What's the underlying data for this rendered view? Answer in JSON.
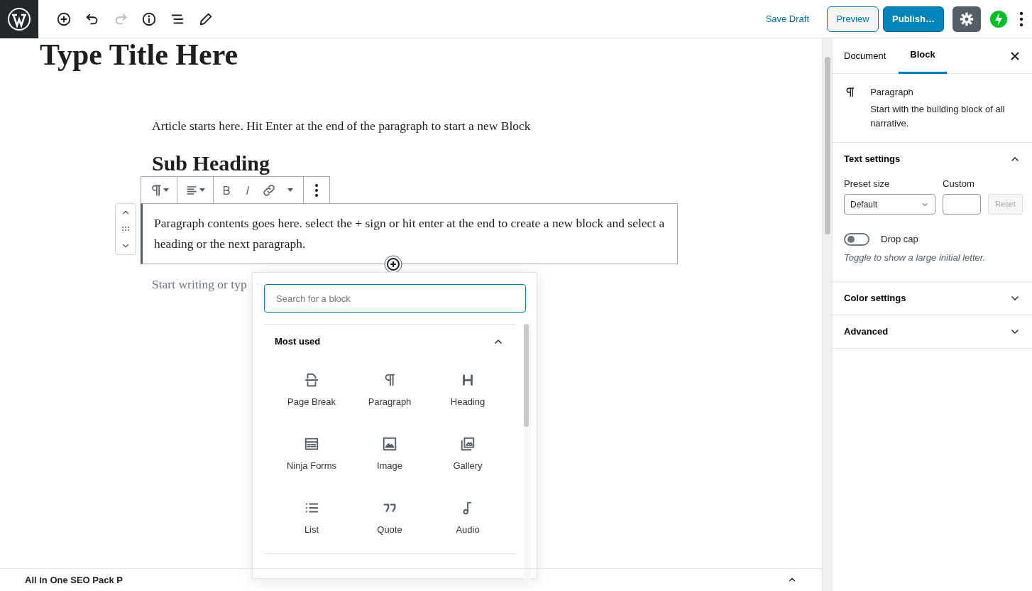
{
  "header": {
    "tools": [
      {
        "kind": "add",
        "disabled": false
      },
      {
        "kind": "undo",
        "disabled": false
      },
      {
        "kind": "redo",
        "disabled": true
      },
      {
        "kind": "info",
        "disabled": false
      },
      {
        "kind": "outline",
        "disabled": false
      },
      {
        "kind": "edit",
        "disabled": false
      }
    ],
    "save_draft": "Save Draft",
    "preview": "Preview",
    "publish": "Publish…",
    "settings": {
      "pressed": true
    }
  },
  "editor": {
    "title": "Type Title Here",
    "blocks": [
      {
        "kind": "paragraph",
        "text": "Article starts here. Hit Enter at the end of the paragraph to start a new Block",
        "selected": false
      },
      {
        "kind": "heading",
        "text": "Sub Heading",
        "selected": false
      },
      {
        "kind": "paragraph",
        "text": "Paragraph contents goes here. select the + sign or hit enter at the end to create a new block and select a heading or the next paragraph.",
        "selected": true
      },
      {
        "kind": "placeholder",
        "text": "Start writing or typ",
        "selected": false
      }
    ]
  },
  "inserter": {
    "search": {
      "placeholder": "Search for a block"
    },
    "section": {
      "title": "Most used",
      "expanded": true
    },
    "blocks": [
      {
        "kind": "pagebreak",
        "label": "Page Break"
      },
      {
        "kind": "paragraph",
        "label": "Paragraph"
      },
      {
        "kind": "heading",
        "label": "Heading"
      },
      {
        "kind": "form",
        "label": "Ninja Forms"
      },
      {
        "kind": "image",
        "label": "Image"
      },
      {
        "kind": "gallery",
        "label": "Gallery"
      },
      {
        "kind": "list",
        "label": "List"
      },
      {
        "kind": "quote",
        "label": "Quote"
      },
      {
        "kind": "audio",
        "label": "Audio"
      }
    ]
  },
  "meta_box": {
    "title": "All in One SEO Pack P"
  },
  "sidebar": {
    "tabs": [
      {
        "label": "Document",
        "selected": false
      },
      {
        "label": "Block",
        "selected": true
      }
    ],
    "block_card": {
      "title": "Paragraph",
      "description": "Start with the building block of all narrative."
    },
    "panels": [
      {
        "kind": "text",
        "title": "Text settings",
        "expanded": true
      },
      {
        "kind": "color",
        "title": "Color settings",
        "expanded": false
      },
      {
        "kind": "advanced",
        "title": "Advanced",
        "expanded": false
      }
    ],
    "text_settings": {
      "preset_label": "Preset size",
      "preset_value": "Default",
      "custom_label": "Custom",
      "reset": "Reset",
      "reset_disabled": true,
      "drop_cap": {
        "label": "Drop cap",
        "on": false
      },
      "help": "Toggle to show a large initial letter."
    }
  }
}
